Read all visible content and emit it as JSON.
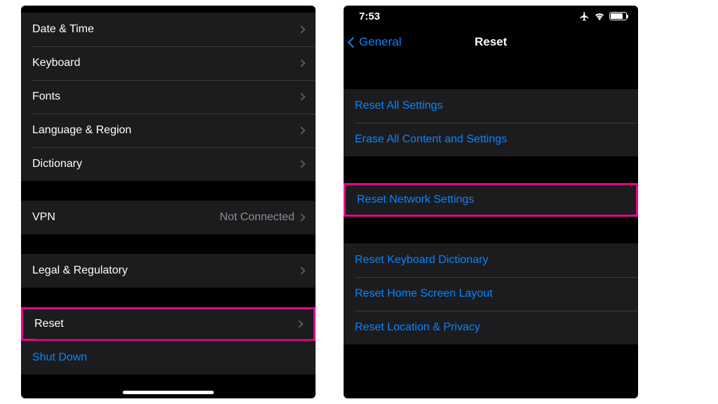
{
  "left": {
    "group1": [
      {
        "label": "Date & Time"
      },
      {
        "label": "Keyboard"
      },
      {
        "label": "Fonts"
      },
      {
        "label": "Language & Region"
      },
      {
        "label": "Dictionary"
      }
    ],
    "vpn": {
      "label": "VPN",
      "value": "Not Connected"
    },
    "legal": {
      "label": "Legal & Regulatory"
    },
    "reset": {
      "label": "Reset"
    },
    "shutdown": {
      "label": "Shut Down"
    }
  },
  "right": {
    "status": {
      "time": "7:53"
    },
    "nav": {
      "back": "General",
      "title": "Reset"
    },
    "group1": [
      {
        "label": "Reset All Settings"
      },
      {
        "label": "Erase All Content and Settings"
      }
    ],
    "network": {
      "label": "Reset Network Settings"
    },
    "group3": [
      {
        "label": "Reset Keyboard Dictionary"
      },
      {
        "label": "Reset Home Screen Layout"
      },
      {
        "label": "Reset Location & Privacy"
      }
    ]
  }
}
